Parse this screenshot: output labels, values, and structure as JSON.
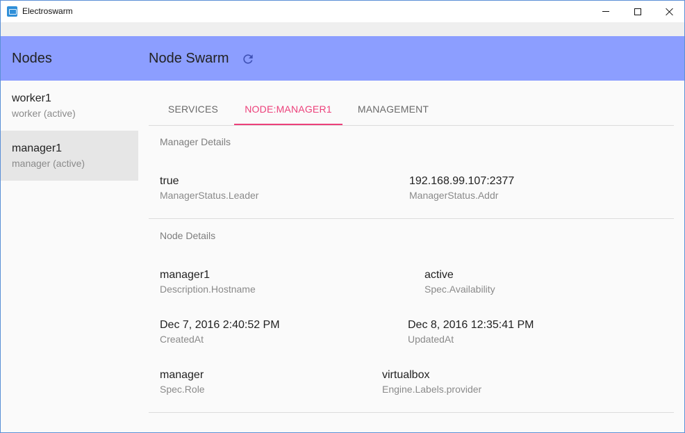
{
  "window": {
    "title": "Electroswarm"
  },
  "header": {
    "sidebar_title": "Nodes",
    "title": "Node Swarm",
    "background": "#8c9eff"
  },
  "sidebar": {
    "items": [
      {
        "name": "worker1",
        "status": "worker (active)",
        "selected": false
      },
      {
        "name": "manager1",
        "status": "manager (active)",
        "selected": true
      }
    ]
  },
  "tabs": [
    {
      "label": "SERVICES",
      "active": false
    },
    {
      "label": "NODE:MANAGER1",
      "active": true
    },
    {
      "label": "MANAGEMENT",
      "active": false
    }
  ],
  "accent_color": "#ec407a",
  "manager_details": {
    "title": "Manager Details",
    "fields": [
      {
        "value": "true",
        "label": "ManagerStatus.Leader"
      },
      {
        "value": "192.168.99.107:2377",
        "label": "ManagerStatus.Addr"
      }
    ]
  },
  "node_details": {
    "title": "Node Details",
    "fields": [
      {
        "value": "manager1",
        "label": "Description.Hostname"
      },
      {
        "value": "active",
        "label": "Spec.Availability"
      },
      {
        "value": "Dec 7, 2016 2:40:52 PM",
        "label": "CreatedAt"
      },
      {
        "value": "Dec 8, 2016 12:35:41 PM",
        "label": "UpdatedAt"
      },
      {
        "value": "manager",
        "label": "Spec.Role"
      },
      {
        "value": "virtualbox",
        "label": "Engine.Labels.provider"
      }
    ]
  }
}
